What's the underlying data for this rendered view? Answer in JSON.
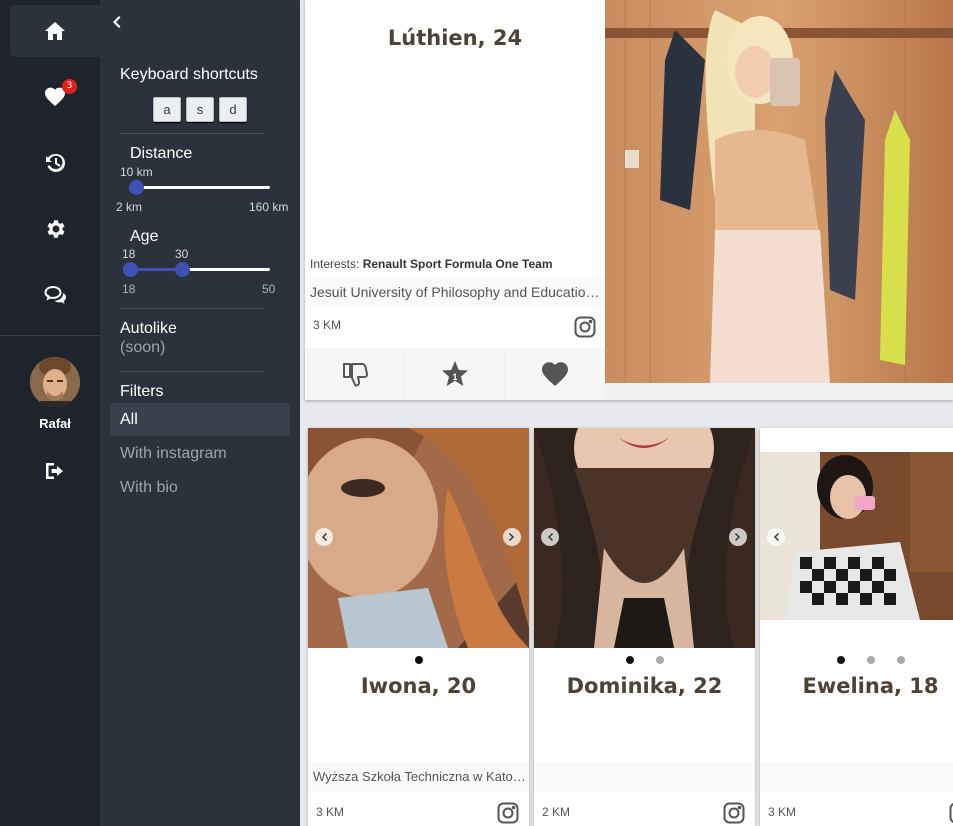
{
  "rail": {
    "likes_badge": "3",
    "username": "Rafał",
    "icons": [
      "home-icon",
      "heart-icon",
      "history-icon",
      "gear-icon",
      "chat-icon",
      "logout-icon"
    ]
  },
  "panel": {
    "keyboard_title": "Keyboard shortcuts",
    "keys": [
      "a",
      "s",
      "d"
    ],
    "distance_title": "Distance",
    "distance_value": "10 km",
    "distance_min": "2 km",
    "distance_max": "160 km",
    "distance_level": 0.05,
    "age_title": "Age",
    "age_low_value": "18",
    "age_high_value": "30",
    "age_min": "18",
    "age_max": "50",
    "autolike_title": "Autolike",
    "autolike_note": "(soon)",
    "filters_title": "Filters",
    "filters": [
      "All",
      "With instagram",
      "With bio"
    ],
    "active_filter": "All"
  },
  "top_profile": {
    "name": "Lúthien, 24",
    "interests_label": "Interests:",
    "interests_value": "Renault Sport Formula One Team",
    "school": "Jesuit University of Philosophy and Education Ignatianum",
    "distance": "3 KM",
    "superlike_count": "1"
  },
  "cards": [
    {
      "name": "Iwona, 20",
      "school": "Wyższa Szkoła Techniczna w Katowicach",
      "distance": "3 KM",
      "photos": 1
    },
    {
      "name": "Dominika, 22",
      "school": "",
      "distance": "2 KM",
      "photos": 2
    },
    {
      "name": "Ewelina, 18",
      "school": "",
      "distance": "3 KM",
      "photos": 3
    }
  ],
  "colors": {
    "rail_bg": "#1f232b",
    "panel_bg": "#2c323c",
    "accent": "#3f51b5",
    "name_color": "#4d4237",
    "badge": "#e0201c"
  }
}
